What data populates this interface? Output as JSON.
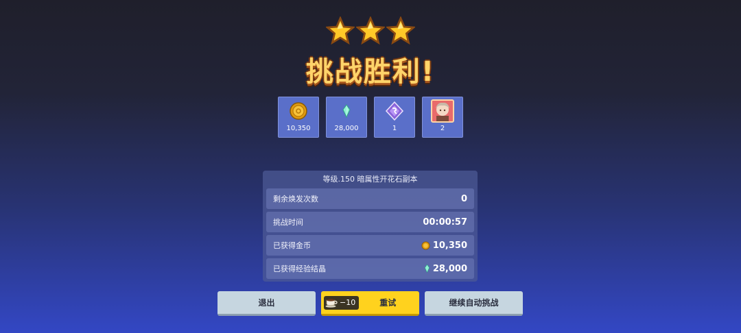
{
  "result": {
    "stars": 3,
    "title": "挑战胜利!"
  },
  "rewards": [
    {
      "icon": "gold-coin-icon",
      "qty": "10,350"
    },
    {
      "icon": "exp-crystal-icon",
      "qty": "28,000"
    },
    {
      "icon": "purple-gem-icon",
      "qty": "1"
    },
    {
      "icon": "character-portrait-icon",
      "qty": "2"
    }
  ],
  "panel": {
    "header": "等级.150  暗属性开花石副本",
    "rows": [
      {
        "label": "剩余焕发次数",
        "value": "0"
      },
      {
        "label": "挑战时间",
        "value": "00:00:57"
      },
      {
        "label": "已获得金币",
        "value": "10,350",
        "icon": "gold-coin-icon"
      },
      {
        "label": "已获得经验结晶",
        "value": "28,000",
        "icon": "exp-crystal-icon"
      }
    ]
  },
  "buttons": {
    "exit": "退出",
    "retry_cost": "−10",
    "retry_cost_icon": "coffee-cup-icon",
    "retry": "重试",
    "auto": "继续自动挑战"
  },
  "colors": {
    "star": "#ffc928",
    "title": "#ffd46a",
    "retry_button": "#ffd21e",
    "secondary_button": "#c6d6e0"
  }
}
